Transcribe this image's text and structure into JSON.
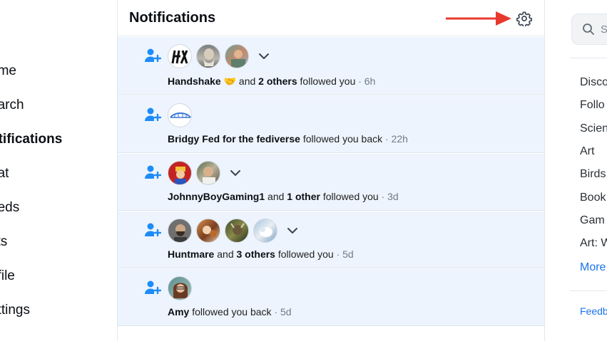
{
  "nav": {
    "items": [
      {
        "label": "ome",
        "active": false
      },
      {
        "label": "earch",
        "active": false
      },
      {
        "label": "otifications",
        "active": true
      },
      {
        "label": "hat",
        "active": false
      },
      {
        "label": "eeds",
        "active": false
      },
      {
        "label": "sts",
        "active": false
      },
      {
        "label": "ofile",
        "active": false
      },
      {
        "label": "ettings",
        "active": false
      }
    ]
  },
  "header": {
    "title": "Notifications",
    "settings_icon": "gear-icon",
    "annotation_color": "#e8392f"
  },
  "notifications": [
    {
      "actor": "Handshake",
      "emoji": "🤝",
      "connector": " and ",
      "others": "2 others",
      "action": " followed you",
      "time": " · 6h",
      "expandable": true
    },
    {
      "actor": "Bridgy Fed for the fediverse",
      "emoji": "",
      "connector": "",
      "others": "",
      "action": " followed you back",
      "time": " · 22h",
      "expandable": false
    },
    {
      "actor": "JohnnyBoyGaming1",
      "emoji": "",
      "connector": " and ",
      "others": "1 other",
      "action": " followed you",
      "time": " · 3d",
      "expandable": true
    },
    {
      "actor": "Huntmare",
      "emoji": "",
      "connector": " and ",
      "others": "3 others",
      "action": " followed you",
      "time": " · 5d",
      "expandable": true
    },
    {
      "actor": "Amy",
      "emoji": "",
      "connector": "",
      "others": "",
      "action": " followed you back",
      "time": " · 5d",
      "expandable": false
    }
  ],
  "right": {
    "search_placeholder": "S",
    "feeds": [
      "Disco",
      "Follo",
      "Scien",
      "Art",
      "Birds",
      "Book",
      "Gam",
      "Art: W"
    ],
    "more_label": "More",
    "feedback_label": "Feedb"
  },
  "colors": {
    "accent": "#1a73e8",
    "notif_bg": "#edf4fd",
    "follow_icon": "#1d8cf8"
  }
}
